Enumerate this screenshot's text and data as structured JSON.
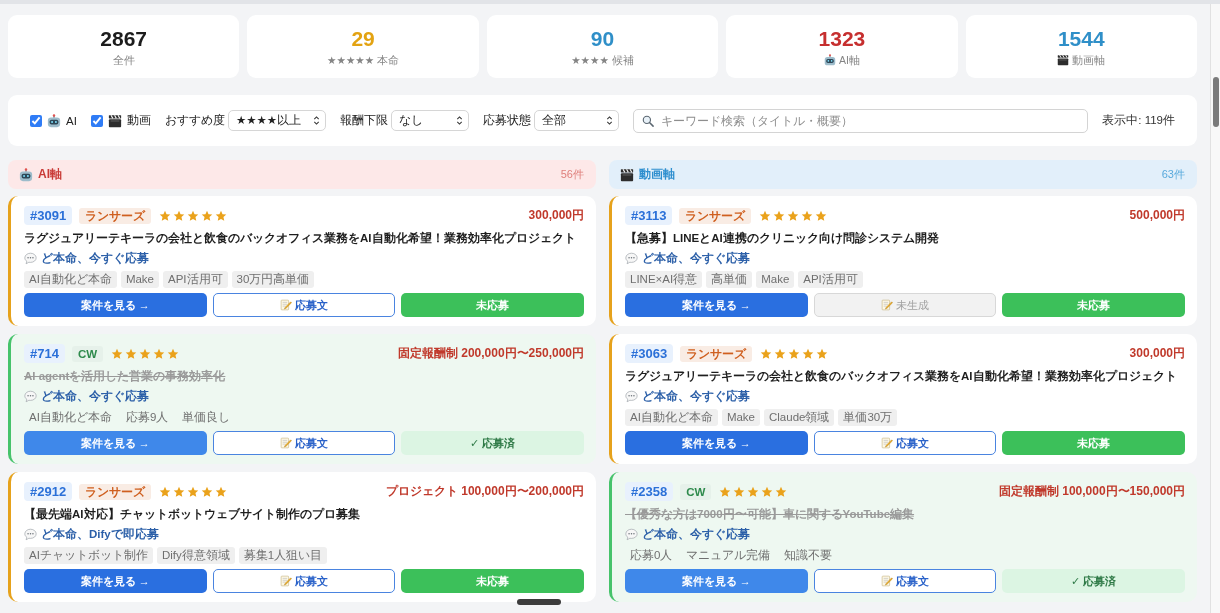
{
  "stats": [
    {
      "value": "2867",
      "label": "全件",
      "color": "#1c1c1c",
      "kind": "plain"
    },
    {
      "value": "29",
      "label": "★★★★★ 本命",
      "color": "#e3a312",
      "kind": "plain"
    },
    {
      "value": "90",
      "label": "★★★★ 候補",
      "color": "#2f8fc8",
      "kind": "plain"
    },
    {
      "value": "1323",
      "label": "AI軸",
      "color": "#c62f2f",
      "kind": "ai"
    },
    {
      "value": "1544",
      "label": "動画軸",
      "color": "#2f8fc8",
      "kind": "video"
    }
  ],
  "filters": {
    "checkboxes": [
      {
        "label": "AI",
        "checked": true,
        "kind": "ai"
      },
      {
        "label": "動画",
        "checked": true,
        "kind": "video"
      }
    ],
    "selects": [
      {
        "label": "おすすめ度",
        "value": "★★★★以上"
      },
      {
        "label": "報酬下限",
        "value": "なし"
      },
      {
        "label": "応募状態",
        "value": "全部"
      }
    ],
    "search": {
      "placeholder": "キーワード検索（タイトル・概要）"
    },
    "result_count": "表示中: 119件"
  },
  "columns": [
    {
      "kind": "ai",
      "title": "AI軸",
      "count": "56件",
      "cards": [
        {
          "id": "#3091",
          "source": {
            "label": "ランサーズ",
            "color": "#cf5f1f"
          },
          "stars": 5,
          "price": "300,000円",
          "title": "ラグジュアリーテキーラの会社と飲食のバックオフィス業務をAI自動化希望！業務効率化プロジェクト",
          "applied": false,
          "comment": "ど本命、今すぐ応募",
          "tags": [
            "AI自動化ど本命",
            "Make",
            "API活用可",
            "30万円高単価"
          ],
          "view_button": "案件を見る →",
          "draft_button": {
            "label": "応募文",
            "disabled": false
          },
          "status_button": "未応募"
        },
        {
          "id": "#714",
          "source": {
            "label": "CW",
            "color": "#2e8a4c"
          },
          "stars": 5,
          "price": "固定報酬制 200,000円〜250,000円",
          "title": "AI agentを活用した営業の事務効率化",
          "applied": true,
          "comment": "ど本命、今すぐ応募",
          "tags": [
            "AI自動化ど本命",
            "応募9人",
            "単価良し"
          ],
          "view_button": "案件を見る →",
          "draft_button": {
            "label": "応募文",
            "disabled": false
          },
          "status_button": "✓ 応募済"
        },
        {
          "id": "#2912",
          "source": {
            "label": "ランサーズ",
            "color": "#cf5f1f"
          },
          "stars": 5,
          "price": "プロジェクト 100,000円〜200,000円",
          "title": "【最先端AI対応】チャットボットウェブサイト制作のプロ募集",
          "applied": false,
          "comment": "ど本命、Difyで即応募",
          "tags": [
            "AIチャットボット制作",
            "Dify得意領域",
            "募集1人狙い目"
          ],
          "view_button": "案件を見る →",
          "draft_button": {
            "label": "応募文",
            "disabled": false
          },
          "status_button": "未応募"
        }
      ]
    },
    {
      "kind": "video",
      "title": "動画軸",
      "count": "63件",
      "cards": [
        {
          "id": "#3113",
          "source": {
            "label": "ランサーズ",
            "color": "#cf5f1f"
          },
          "stars": 5,
          "price": "500,000円",
          "title": "【急募】LINEとAI連携のクリニック向け問診システム開発",
          "applied": false,
          "comment": "ど本命、今すぐ応募",
          "tags": [
            "LINE×AI得意",
            "高単価",
            "Make",
            "API活用可"
          ],
          "view_button": "案件を見る →",
          "draft_button": {
            "label": "未生成",
            "disabled": true
          },
          "status_button": "未応募"
        },
        {
          "id": "#3063",
          "source": {
            "label": "ランサーズ",
            "color": "#cf5f1f"
          },
          "stars": 5,
          "price": "300,000円",
          "title": "ラグジュアリーテキーラの会社と飲食のバックオフィス業務をAI自動化希望！業務効率化プロジェクト",
          "applied": false,
          "comment": "ど本命、今すぐ応募",
          "tags": [
            "AI自動化ど本命",
            "Make",
            "Claude領域",
            "単価30万"
          ],
          "view_button": "案件を見る →",
          "draft_button": {
            "label": "応募文",
            "disabled": false
          },
          "status_button": "未応募"
        },
        {
          "id": "#2358",
          "source": {
            "label": "CW",
            "color": "#2e8a4c"
          },
          "stars": 5,
          "price": "固定報酬制 100,000円〜150,000円",
          "title": "【優秀な方は7000円〜可能】車に関するYouTube編集",
          "applied": true,
          "comment": "ど本命、今すぐ応募",
          "tags": [
            "応募0人",
            "マニュアル完備",
            "知識不要"
          ],
          "view_button": "案件を見る →",
          "draft_button": {
            "label": "応募文",
            "disabled": false
          },
          "status_button": "✓ 応募済"
        }
      ]
    }
  ]
}
